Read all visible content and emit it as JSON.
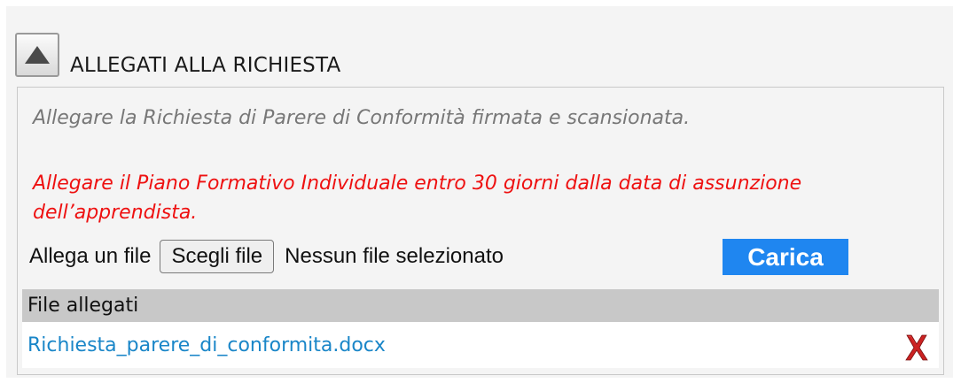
{
  "section": {
    "title": "ALLEGATI ALLA RICHIESTA",
    "toggle_icon": "triangle-up-icon"
  },
  "notes": {
    "info": "Allegare la Richiesta di Parere di Conformità firmata e scansionata.",
    "warning": "Allegare il Piano Formativo Individuale entro 30 giorni dalla data di assunzione dell’apprendista."
  },
  "upload": {
    "label": "Allega un file",
    "choose_button": "Scegli file",
    "no_file_text": "Nessun file selezionato",
    "upload_button": "Carica"
  },
  "attachments": {
    "header": "File allegati",
    "files": [
      {
        "name": "Richiesta_parere_di_conformita.docx",
        "delete_icon": "delete-x-icon"
      }
    ]
  },
  "colors": {
    "accent": "#1f86f0",
    "warning": "#ee1111",
    "link": "#1a86c8",
    "delete": "#cc2222"
  }
}
